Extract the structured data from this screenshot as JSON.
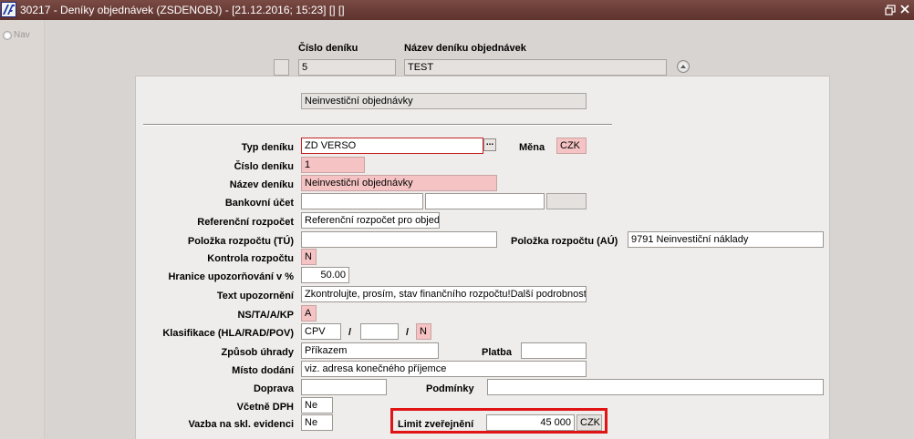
{
  "window": {
    "title": "30217 - Deníky objednávek (ZSDENOBJ) - [21.12.2016; 15:23] [] []"
  },
  "nav": {
    "label": "Nav"
  },
  "header": {
    "col_number_label": "Číslo deníku",
    "col_name_label": "Název deníku objednávek",
    "number_value": "5",
    "name_value": "TEST"
  },
  "detail": {
    "subtitle": "Neinvestiční objednávky",
    "typ_deniku": {
      "label": "Typ deníku",
      "value": "ZD VERSO"
    },
    "mena": {
      "label": "Měna",
      "value": "CZK"
    },
    "cislo_deniku": {
      "label": "Číslo deníku",
      "value": "1"
    },
    "nazev_deniku": {
      "label": "Název deníku",
      "value": "Neinvestiční objednávky"
    },
    "bankovni_ucet": {
      "label": "Bankovní účet",
      "value1": "",
      "value2": "",
      "value3": ""
    },
    "referencni_rozpocet": {
      "label": "Referenční rozpočet",
      "value": "Referenční rozpočet pro objed"
    },
    "polozka_tu": {
      "label": "Položka rozpočtu (TÚ)",
      "value": ""
    },
    "polozka_au": {
      "label": "Položka rozpočtu (AÚ)",
      "value": "9791 Neinvestiční náklady"
    },
    "kontrola_rozpoctu": {
      "label": "Kontrola rozpočtu",
      "value": "N"
    },
    "hranice": {
      "label": "Hranice upozorňování v %",
      "value": "50.00"
    },
    "text_upozorneni": {
      "label": "Text upozornění",
      "value": "Zkontrolujte, prosím, stav finančního rozpočtu!Další podrobnosti"
    },
    "ns_ta": {
      "label": "NS/TA/A/KP",
      "value": "A"
    },
    "klasifikace": {
      "label": "Klasifikace (HLA/RAD/POV)",
      "v1": "CPV",
      "v2": "",
      "v3": "N",
      "sep": "/"
    },
    "zpusob_uhrady": {
      "label": "Způsob úhrady",
      "value": "Příkazem"
    },
    "platba": {
      "label": "Platba",
      "value": ""
    },
    "misto_dodani": {
      "label": "Místo dodání",
      "value": "viz. adresa konečného příjemce"
    },
    "doprava": {
      "label": "Doprava",
      "value": ""
    },
    "podminky": {
      "label": "Podmínky",
      "value": ""
    },
    "vcetne_dph": {
      "label": "Včetně DPH",
      "value": "Ne"
    },
    "vazba": {
      "label": "Vazba na skl. evidenci",
      "value": "Ne"
    },
    "limit": {
      "label": "Limit zveřejnění",
      "value": "45 000",
      "currency": "CZK"
    },
    "ellipsis": "..."
  },
  "colors": {
    "titlebar": "#6a3b35",
    "required_field": "#f5c3c3",
    "highlight_border": "#e01414"
  }
}
